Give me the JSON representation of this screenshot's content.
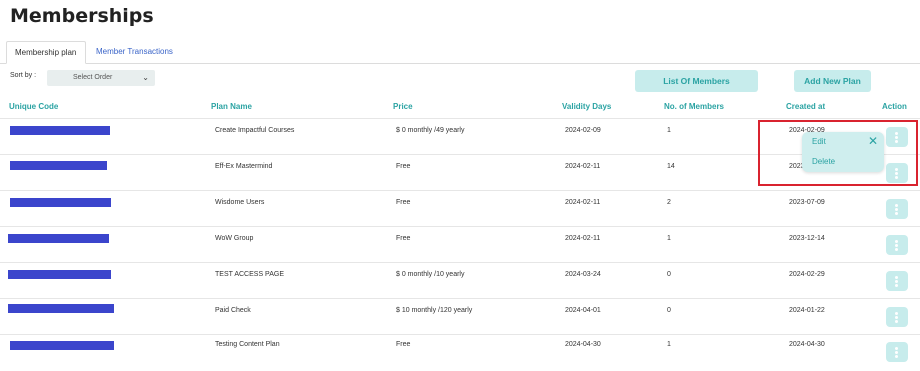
{
  "page_title": "Memberships",
  "tabs": [
    {
      "label": "Membership plan"
    },
    {
      "label": "Member Transactions"
    }
  ],
  "toolbar": {
    "sort_label": "Sort by :",
    "sort_value": "Select Order",
    "list_members_label": "List Of Members",
    "add_plan_label": "Add New Plan"
  },
  "columns": [
    "Unique Code",
    "Plan Name",
    "Price",
    "Validity Days",
    "No. of Members",
    "Created at",
    "Action"
  ],
  "rows": [
    {
      "plan": "Create Impactful Courses",
      "price": "$ 0 monthly /49 yearly",
      "validity": "2024-02-09",
      "members": "1",
      "created": "2024-02-09"
    },
    {
      "plan": "Eff-Ex Mastermind",
      "price": "Free",
      "validity": "2024-02-11",
      "members": "14",
      "created": "2023"
    },
    {
      "plan": "Wisdome Users",
      "price": "Free",
      "validity": "2024-02-11",
      "members": "2",
      "created": "2023-07-09"
    },
    {
      "plan": "WoW Group",
      "price": "Free",
      "validity": "2024-02-11",
      "members": "1",
      "created": "2023-12-14"
    },
    {
      "plan": "TEST ACCESS PAGE",
      "price": "$ 0 monthly /10 yearly",
      "validity": "2024-03-24",
      "members": "0",
      "created": "2024-02-29"
    },
    {
      "plan": "Paid Check",
      "price": "$ 10 monthly /120 yearly",
      "validity": "2024-04-01",
      "members": "0",
      "created": "2024-01-22"
    },
    {
      "plan": "Testing Content Plan",
      "price": "Free",
      "validity": "2024-04-30",
      "members": "1",
      "created": "2024-04-30"
    }
  ],
  "menu": {
    "edit_label": "Edit",
    "delete_label": "Delete",
    "close_glyph": "✕"
  },
  "colors": {
    "accent": "#2ba3a3",
    "accent_bg": "#c7ecec",
    "code_redaction": "#3b45cc",
    "highlight": "#d9232f"
  }
}
